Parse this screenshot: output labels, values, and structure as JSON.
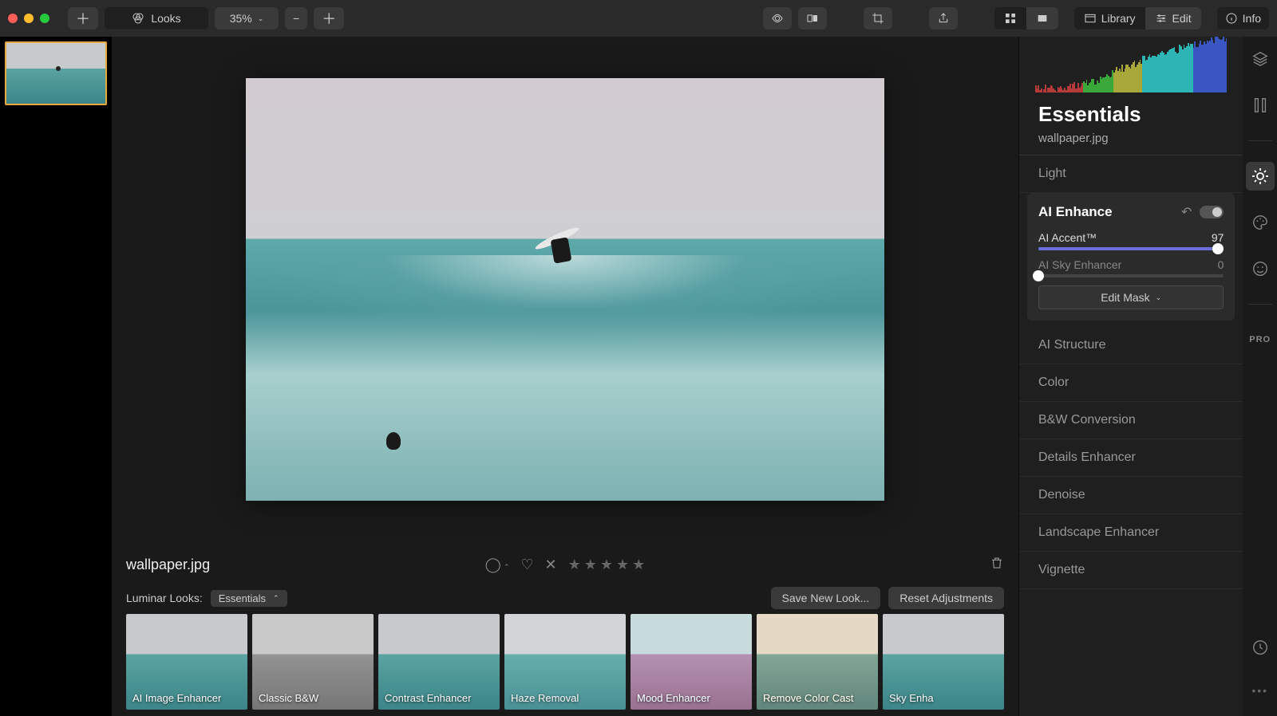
{
  "toolbar": {
    "looks_label": "Looks",
    "zoom": "35%",
    "library": "Library",
    "edit": "Edit",
    "info": "Info"
  },
  "canvas": {
    "filename": "wallpaper.jpg"
  },
  "looks": {
    "label": "Luminar Looks:",
    "category": "Essentials",
    "save_btn": "Save New Look...",
    "reset_btn": "Reset Adjustments",
    "items": [
      "AI Image Enhancer",
      "Classic B&W",
      "Contrast Enhancer",
      "Haze Removal",
      "Mood Enhancer",
      "Remove Color Cast",
      "Sky Enha"
    ]
  },
  "panel": {
    "title": "Essentials",
    "filename": "wallpaper.jpg",
    "sections": {
      "light": "Light",
      "ai_structure": "AI Structure",
      "color": "Color",
      "bw": "B&W Conversion",
      "details": "Details Enhancer",
      "denoise": "Denoise",
      "landscape": "Landscape Enhancer",
      "vignette": "Vignette"
    },
    "ai_enhance": {
      "title": "AI Enhance",
      "accent_label": "AI Accent™",
      "accent_value": "97",
      "sky_label": "AI Sky Enhancer",
      "sky_value": "0",
      "edit_mask": "Edit Mask"
    }
  },
  "tool_rail": {
    "pro": "PRO"
  }
}
